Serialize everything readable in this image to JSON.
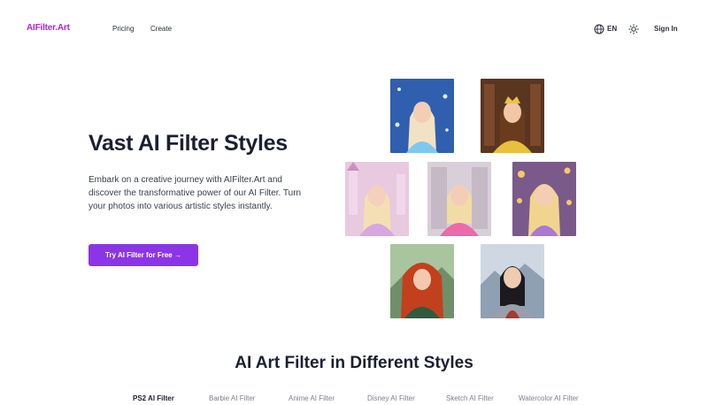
{
  "header": {
    "logo": "AIFilter.Art",
    "nav": [
      "Pricing",
      "Create"
    ],
    "language": "EN",
    "sign_in": "Sign In"
  },
  "hero": {
    "title": "Vast AI Filter Styles",
    "description": "Embark on a creative journey with AIFilter.Art and discover the transformative power of our AI Filter. Turn your photos into various artistic styles instantly.",
    "cta": "Try AI Filter for Free →"
  },
  "section": {
    "title": "AI Art Filter in Different Styles",
    "tabs": [
      "PS2 AI Filter",
      "Barbie AI Filter",
      "Anime AI Filter",
      "Disney AI Filter",
      "Sketch AI Filter",
      "Watercolor AI Filter"
    ]
  },
  "colors": {
    "brand": "#a32bd6",
    "accent": "#8c35e8",
    "text": "#1b2030"
  },
  "icons": [
    "globe-icon",
    "sun-icon",
    "arrow-right-icon"
  ]
}
